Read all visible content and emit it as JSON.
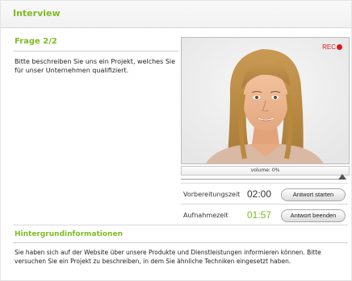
{
  "header": {
    "title": "Interview"
  },
  "question": {
    "counter": "Frage 2/2",
    "text": "Bitte beschreiben Sie uns ein Projekt, welches Sie für unser Unternehmen qualifiziert."
  },
  "video": {
    "rec_label": "REC",
    "rec_color": "#e01818"
  },
  "volume": {
    "label": "volume: 0%",
    "level": 0
  },
  "preparation": {
    "label": "Vorbereitungszeit",
    "time": "02:00",
    "button": "Antwort starten"
  },
  "recording": {
    "label": "Aufnahmezeit",
    "time": "01:57",
    "button": "Antwort beenden"
  },
  "background": {
    "title": "Hintergrundinformationen",
    "text": "Sie haben sich auf der Website über unsere Produkte und Dienstleistungen informieren können. Bitte versuchen Sie ein Projekt zu beschreiben, in dem Sie ähnliche Techniken eingesetzt haben."
  },
  "colors": {
    "accent": "#7dbb22",
    "prep_time": "#333333",
    "rec_time": "#7dbb22"
  }
}
